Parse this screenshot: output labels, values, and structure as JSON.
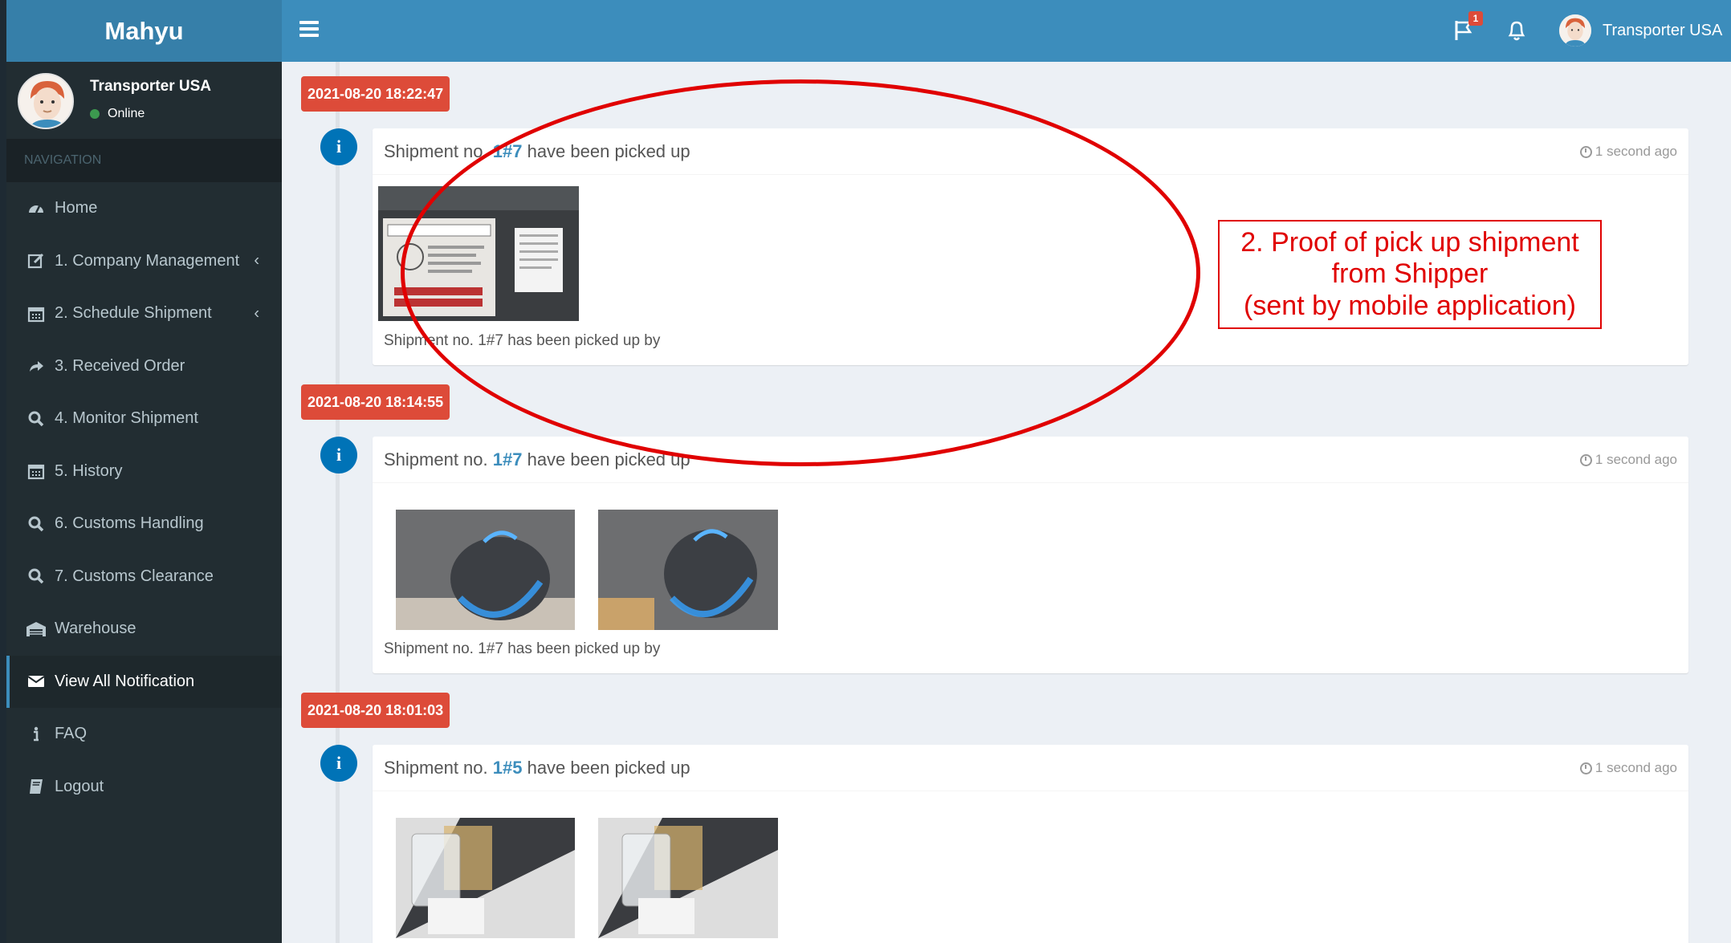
{
  "app": {
    "brand": "Mahyu"
  },
  "user": {
    "name": "Transporter USA",
    "status": "Online"
  },
  "sidebar": {
    "header": "NAVIGATION",
    "items": [
      {
        "label": "Home",
        "icon": "dashboard-icon",
        "chevron": false,
        "active": false
      },
      {
        "label": "1. Company Management",
        "icon": "edit-icon",
        "chevron": true,
        "active": false
      },
      {
        "label": "2. Schedule Shipment",
        "icon": "calendar-icon",
        "chevron": true,
        "active": false
      },
      {
        "label": "3. Received Order",
        "icon": "share-icon",
        "chevron": false,
        "active": false
      },
      {
        "label": "4. Monitor Shipment",
        "icon": "search-icon",
        "chevron": false,
        "active": false
      },
      {
        "label": "5. History",
        "icon": "calendar-icon",
        "chevron": false,
        "active": false
      },
      {
        "label": "6. Customs Handling",
        "icon": "search-icon",
        "chevron": false,
        "active": false
      },
      {
        "label": "7. Customs Clearance",
        "icon": "search-icon",
        "chevron": false,
        "active": false
      },
      {
        "label": "Warehouse",
        "icon": "warehouse-icon",
        "chevron": false,
        "active": false
      },
      {
        "label": "View All Notification",
        "icon": "envelope-icon",
        "chevron": false,
        "active": true
      },
      {
        "label": "FAQ",
        "icon": "info-icon",
        "chevron": false,
        "active": false
      },
      {
        "label": "Logout",
        "icon": "book-icon",
        "chevron": false,
        "active": false
      }
    ]
  },
  "topbar": {
    "flag_badge": "1",
    "user_name": "Transporter USA"
  },
  "timeline": [
    {
      "time_label": "2021-08-20 18:22:47",
      "title_prefix": "Shipment no. ",
      "shipment_no": "1#7",
      "title_suffix": " have been picked up",
      "ago": "1 second ago",
      "footer": "Shipment no. 1#7 has been picked up by",
      "photos": [
        "package-photo"
      ]
    },
    {
      "time_label": "2021-08-20 18:14:55",
      "title_prefix": "Shipment no. ",
      "shipment_no": "1#7",
      "title_suffix": " have been picked up",
      "ago": "1 second ago",
      "footer": "Shipment no. 1#7 has been picked up by",
      "photos": [
        "mouse-photo",
        "mouse-photo"
      ]
    },
    {
      "time_label": "2021-08-20 18:01:03",
      "title_prefix": "Shipment no. ",
      "shipment_no": "1#5",
      "title_suffix": " have been picked up",
      "ago": "1 second ago",
      "footer": "",
      "photos": [
        "glass-photo",
        "glass-photo"
      ]
    }
  ],
  "annotation": {
    "line1": "2. Proof of pick up shipment",
    "line2": "from Shipper",
    "line3": "(sent by mobile application)",
    "color": "#e00000"
  },
  "colors": {
    "topbar": "#3c8dbc",
    "logo": "#367fa9",
    "sidebar": "#222d32",
    "time_label": "#dd4b39",
    "info_icon": "#0073b7"
  }
}
